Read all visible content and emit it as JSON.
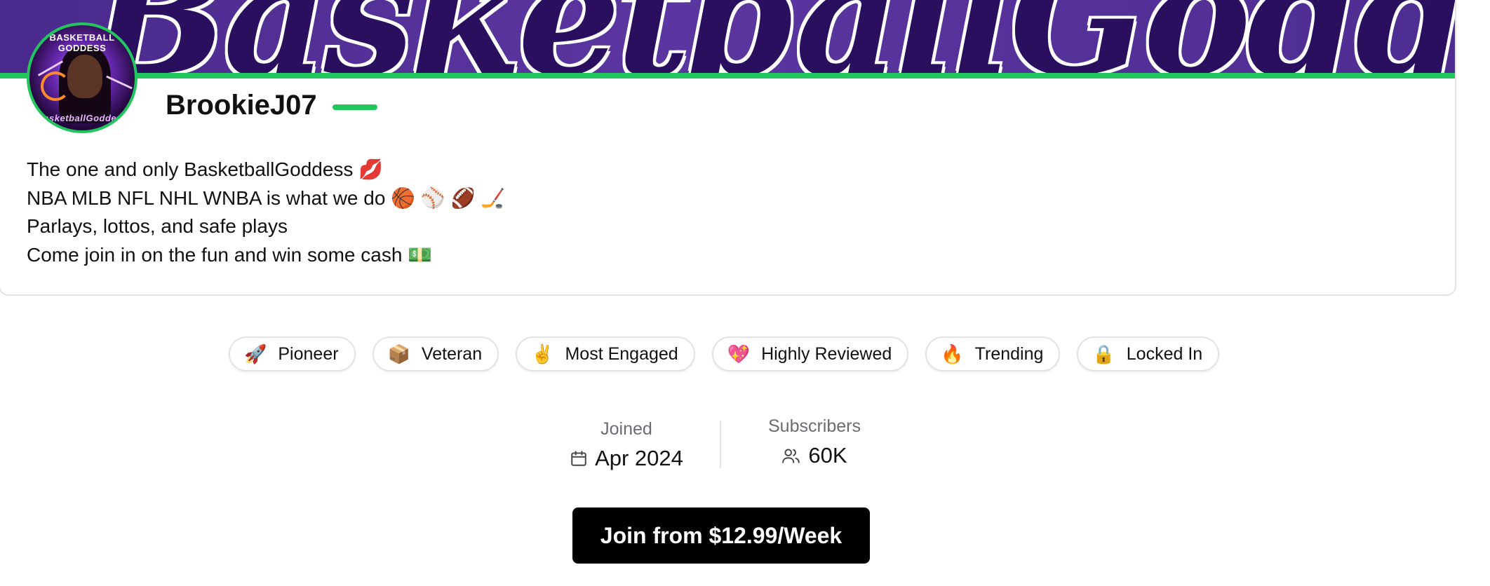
{
  "profile": {
    "banner_text": "BasketballGoddess",
    "avatar_caption_top": "BASKETBALL GODDESS",
    "avatar_caption_bottom": "BasketballGoddess",
    "username": "BrookieJ07",
    "bio": [
      "The one and only BasketballGoddess 💋",
      "NBA MLB NFL NHL WNBA is what we do 🏀 ⚾ 🏈 🏒",
      "Parlays, lottos, and safe plays",
      "Come join in on the fun and win some cash 💵"
    ]
  },
  "badges": [
    {
      "icon": "🚀",
      "label": "Pioneer"
    },
    {
      "icon": "📦",
      "label": "Veteran"
    },
    {
      "icon": "✌️",
      "label": "Most Engaged"
    },
    {
      "icon": "💖",
      "label": "Highly Reviewed"
    },
    {
      "icon": "🔥",
      "label": "Trending"
    },
    {
      "icon": "🔒",
      "label": "Locked In"
    }
  ],
  "stats": {
    "joined_label": "Joined",
    "joined_value": "Apr 2024",
    "subscribers_label": "Subscribers",
    "subscribers_value": "60K"
  },
  "cta": {
    "join_label": "Join from $12.99/Week"
  },
  "colors": {
    "accent_green": "#22c55e",
    "banner_purple": "#4a2a8c",
    "button_black": "#000000"
  }
}
